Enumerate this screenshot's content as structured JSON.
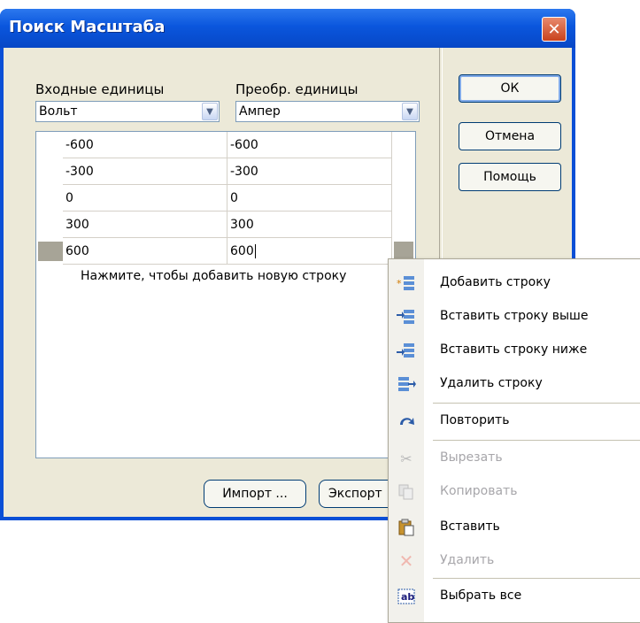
{
  "dialog": {
    "title": "Поиск Масштаба",
    "close_glyph": "✕",
    "input_units_label": "Входные единицы",
    "converted_units_label": "Преобр. единицы",
    "input_units_value": "Вольт",
    "converted_units_value": "Ампер",
    "rows": [
      {
        "input": "-600",
        "output": "-600"
      },
      {
        "input": "-300",
        "output": "-300"
      },
      {
        "input": "0",
        "output": "0"
      },
      {
        "input": "300",
        "output": "300"
      },
      {
        "input": "600",
        "output": "600"
      }
    ],
    "add_row_hint": "Нажмите, чтобы добавить новую строку",
    "ok_label": "ОК",
    "cancel_label": "Отмена",
    "help_label": "Помощь",
    "import_label": "Импорт ...",
    "export_label": "Экспорт"
  },
  "context_menu": {
    "items": [
      {
        "label": "Добавить строку",
        "icon": "add-row-icon",
        "enabled": true
      },
      {
        "label": "Вставить строку выше",
        "icon": "insert-above-icon",
        "enabled": true
      },
      {
        "label": "Вставить строку ниже",
        "icon": "insert-below-icon",
        "enabled": true
      },
      {
        "label": "Удалить строку",
        "icon": "delete-row-icon",
        "enabled": true
      },
      {
        "label": "Повторить",
        "icon": "redo-icon",
        "enabled": true
      },
      {
        "label": "Вырезать",
        "icon": "cut-icon",
        "enabled": false
      },
      {
        "label": "Копировать",
        "icon": "copy-icon",
        "enabled": false
      },
      {
        "label": "Вставить",
        "icon": "paste-icon",
        "enabled": true
      },
      {
        "label": "Удалить",
        "icon": "delete-icon",
        "enabled": false
      },
      {
        "label": "Выбрать все",
        "icon": "select-all-icon",
        "enabled": true
      }
    ]
  },
  "colors": {
    "titlebar": "#0a56dd",
    "client": "#ece9d8",
    "close_button": "#c9421c",
    "disabled_text": "#a7a6aa"
  }
}
